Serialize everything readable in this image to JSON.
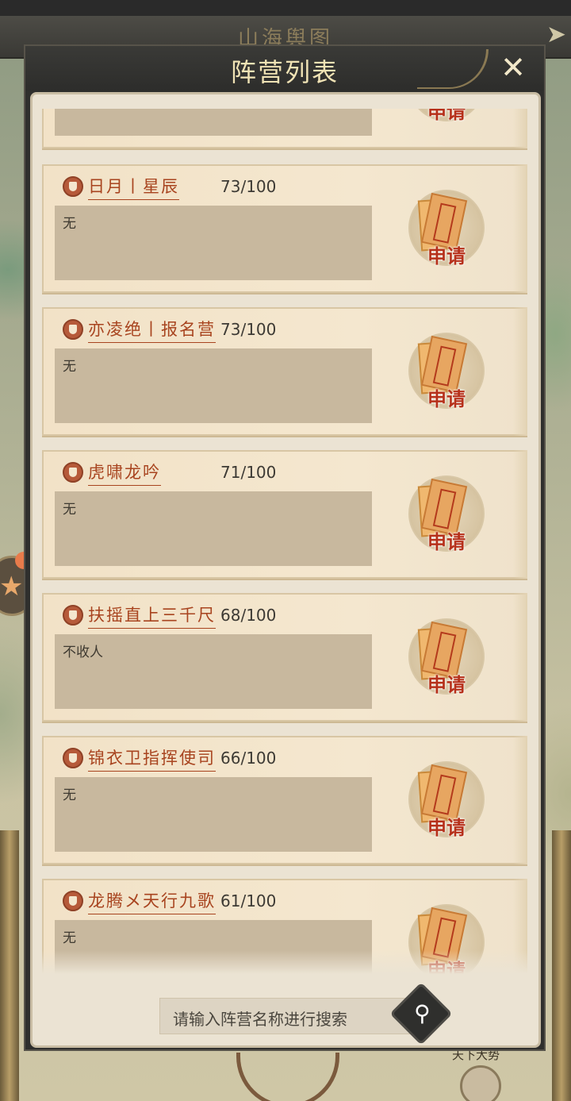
{
  "background": {
    "title": "山海舆图",
    "bottom_text": "天下大势"
  },
  "panel": {
    "title": "阵营列表",
    "close_icon": "close-x-icon"
  },
  "apply_label": "申请",
  "factions": [
    {
      "name": "",
      "count": "",
      "description": ""
    },
    {
      "name": "日月丨星辰",
      "count": "73/100",
      "description": "无"
    },
    {
      "name": "亦凌绝丨报名营",
      "count": "73/100",
      "description": "无"
    },
    {
      "name": "虎啸龙吟",
      "count": "71/100",
      "description": "无"
    },
    {
      "name": "扶摇直上三千尺",
      "count": "68/100",
      "description": "不收人"
    },
    {
      "name": "锦衣卫指挥使司",
      "count": "66/100",
      "description": "无"
    },
    {
      "name": "龙腾メ天行九歌",
      "count": "61/100",
      "description": "无"
    }
  ],
  "search": {
    "placeholder": "请输入阵营名称进行搜索",
    "icon": "search-icon"
  },
  "colors": {
    "faction_name": "#a8441f",
    "apply_label": "#b6301a",
    "panel_header": "#2f2f2d",
    "panel_body": "#ebe3d3"
  }
}
